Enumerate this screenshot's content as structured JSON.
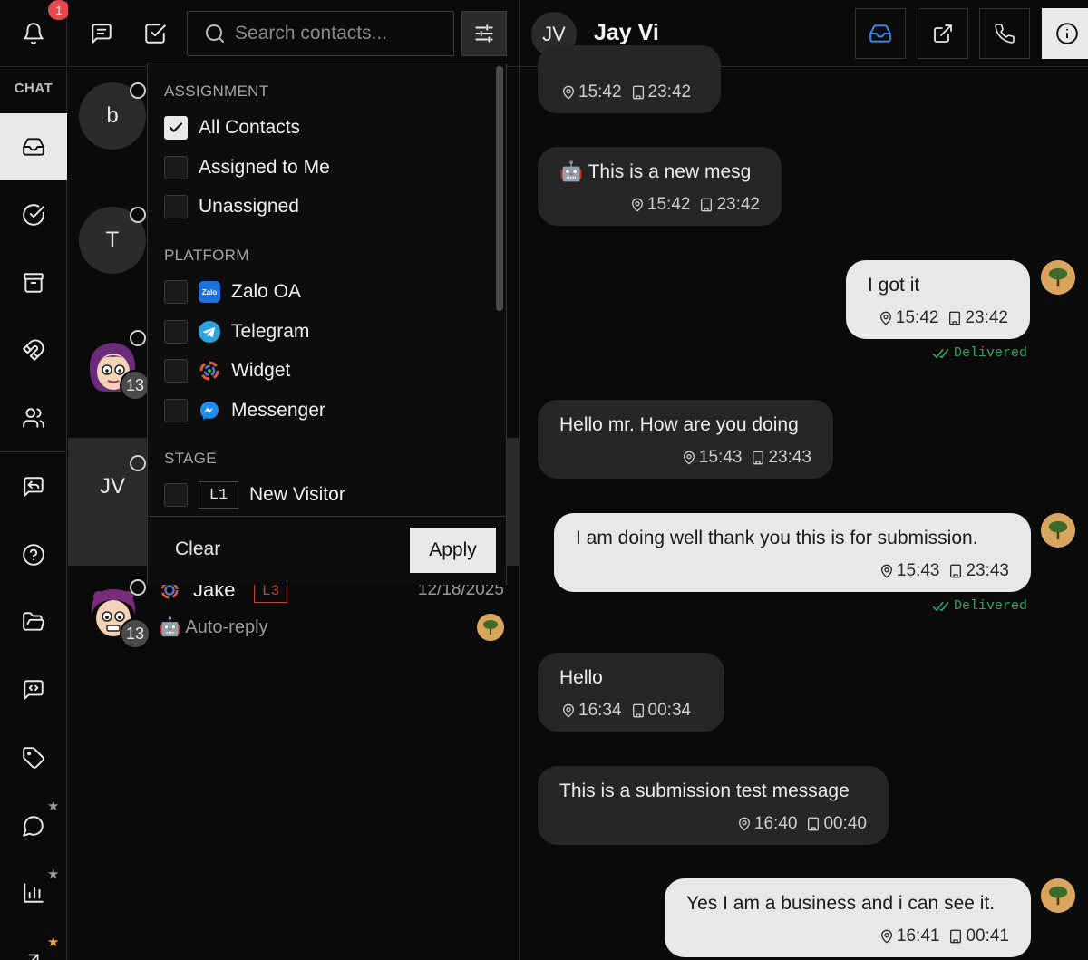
{
  "rail": {
    "notification_count": "1",
    "section_label": "CHAT",
    "items": [
      {
        "name": "inbox-icon"
      },
      {
        "name": "check-circle-icon"
      },
      {
        "name": "archive-icon"
      },
      {
        "name": "magnet-icon"
      },
      {
        "name": "users-icon"
      },
      {
        "name": "reply-icon"
      },
      {
        "name": "help-icon"
      },
      {
        "name": "folder-icon"
      },
      {
        "name": "code-message-icon"
      },
      {
        "name": "tag-icon"
      },
      {
        "name": "chat-bubble-icon"
      },
      {
        "name": "bar-chart-icon"
      }
    ],
    "star": "★"
  },
  "contacts_toolbar": {
    "search_placeholder": "Search contacts..."
  },
  "contacts": [
    {
      "initial": "b"
    },
    {
      "initial": "T"
    },
    {
      "avatar": "cartoon",
      "badge": "13"
    },
    {
      "initial": "JV"
    },
    {
      "name": "Jake",
      "stage": "L3",
      "date": "12/18/2025",
      "preview": "Auto-reply",
      "badge": "13"
    }
  ],
  "filter": {
    "assignment_title": "ASSIGNMENT",
    "assignment": [
      {
        "label": "All Contacts",
        "checked": true
      },
      {
        "label": "Assigned to Me",
        "checked": false
      },
      {
        "label": "Unassigned",
        "checked": false
      }
    ],
    "platform_title": "PLATFORM",
    "platforms": [
      {
        "label": "Zalo OA",
        "icon": "zalo-icon"
      },
      {
        "label": "Telegram",
        "icon": "telegram-icon"
      },
      {
        "label": "Widget",
        "icon": "widget-icon"
      },
      {
        "label": "Messenger",
        "icon": "messenger-icon"
      }
    ],
    "stage_title": "STAGE",
    "stages": [
      {
        "level": "L1",
        "label": "New Visitor"
      }
    ],
    "zalo_icon_text": "Zalo",
    "clear_label": "Clear",
    "apply_label": "Apply"
  },
  "chat": {
    "initials": "JV",
    "title": "Jay Vi",
    "delivered_label": "Delivered",
    "messages": [
      {
        "dir": "in",
        "text": "",
        "time_local": "15:42",
        "time_business": "23:42"
      },
      {
        "dir": "in",
        "text": "🤖 This is a new mesg",
        "time_local": "15:42",
        "time_business": "23:42"
      },
      {
        "dir": "out",
        "text": "I got it",
        "time_local": "15:42",
        "time_business": "23:42",
        "delivered": true
      },
      {
        "dir": "in",
        "text": "Hello mr. How are you doing",
        "time_local": "15:43",
        "time_business": "23:43"
      },
      {
        "dir": "out",
        "text": "I am doing well thank you this is for submission.",
        "time_local": "15:43",
        "time_business": "23:43",
        "delivered": true
      },
      {
        "dir": "in",
        "text": "Hello",
        "time_local": "16:34",
        "time_business": "00:34"
      },
      {
        "dir": "in",
        "text": "This is a submission test message",
        "time_local": "16:40",
        "time_business": "00:40"
      },
      {
        "dir": "out",
        "text": "Yes I am a business and i can see it.",
        "time_local": "16:41",
        "time_business": "00:41"
      }
    ]
  },
  "colors": {
    "background": "#0a0a0a",
    "bubble_in": "#262626",
    "bubble_out": "#e8e8e8",
    "delivered": "#2fa36b",
    "notification": "#e5484d",
    "stage_tag": "#c0452f"
  }
}
